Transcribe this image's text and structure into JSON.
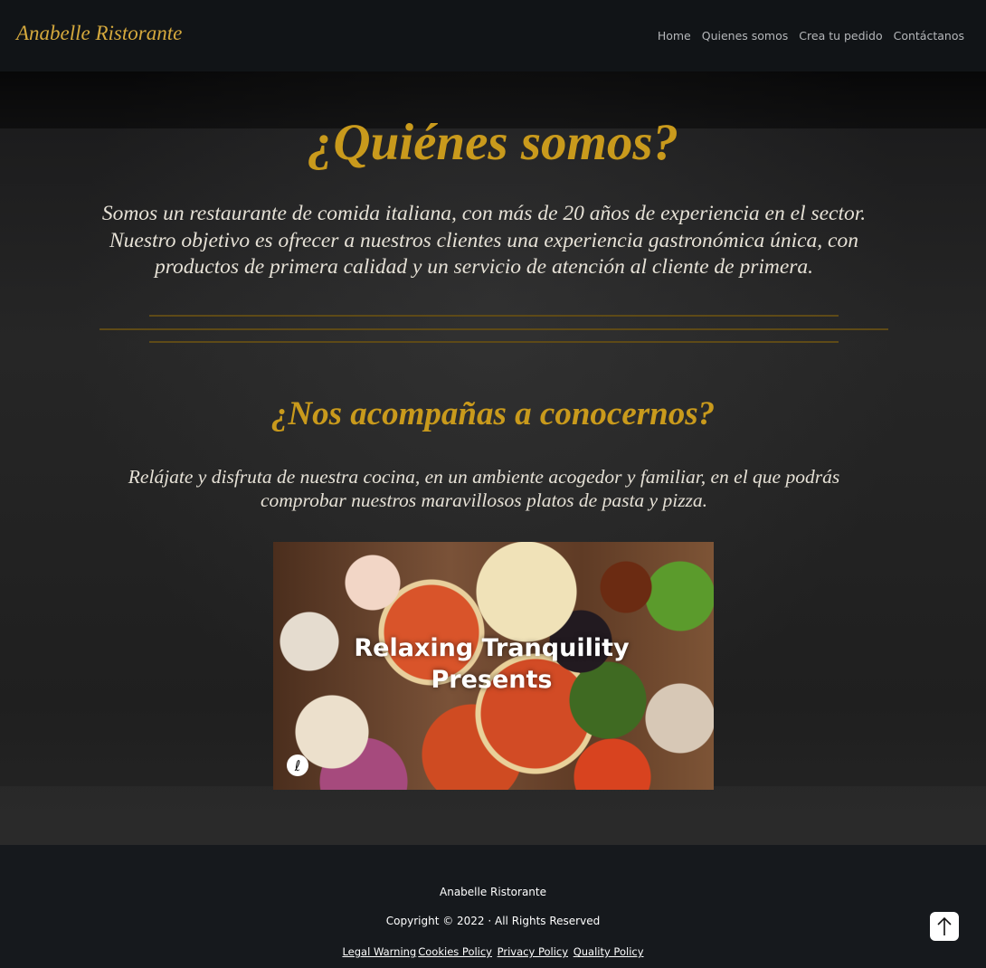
{
  "header": {
    "brand": "Anabelle Ristorante",
    "nav": [
      "Home",
      "Quienes somos",
      "Crea tu pedido",
      "Contáctanos"
    ]
  },
  "about": {
    "title": "¿Quiénes somos?",
    "text": "Somos un restaurante de comida italiana, con más de 20 años de experiencia en el sector. Nuestro objetivo es ofrecer a nuestros clientes una experiencia gastronómica única, con productos de primera calidad y un servicio de atención al cliente de primera."
  },
  "invite": {
    "title": "¿Nos acompañas a conocernos?",
    "text": "Relájate y disfruta de nuestra cocina, en un ambiente acogedor y familiar, en el que podrás comprobar nuestros maravillosos platos de pasta y pizza."
  },
  "video": {
    "title_line1": "Relaxing Tranquility",
    "title_line2": "Presents"
  },
  "footer": {
    "name": "Anabelle Ristorante",
    "copyright": "Copyright © 2022  · All Rights Reserved",
    "links": [
      "Legal Warning",
      "Cookies Policy",
      "Privacy Policy",
      "Quality Policy"
    ]
  },
  "colors": {
    "accent_gold": "#c99a1c",
    "brand_gold": "#d5a93d",
    "background": "#16191d"
  },
  "icons": {
    "back_to_top": "arrow-up-icon",
    "video_channel": "channel-logo-icon"
  }
}
